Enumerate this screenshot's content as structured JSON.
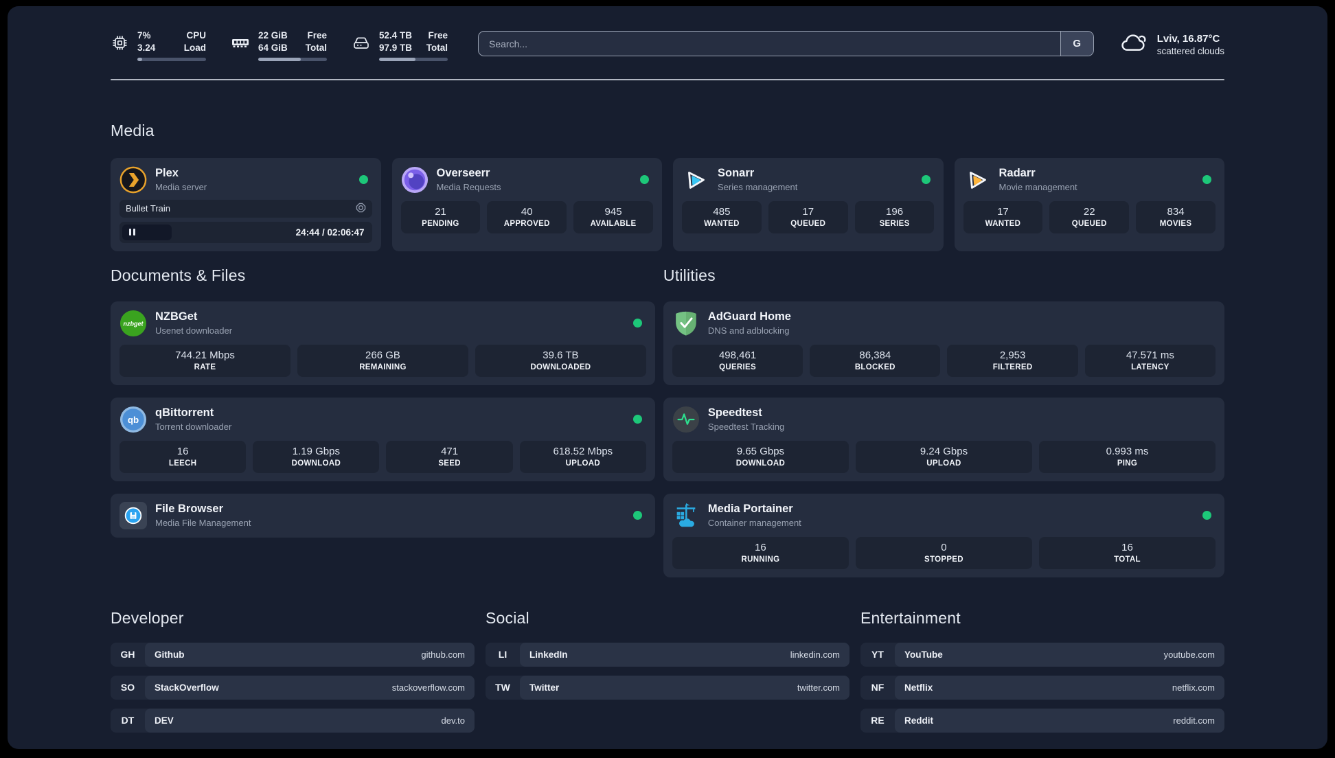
{
  "header": {
    "metrics": [
      {
        "icon": "cpu-icon",
        "values": [
          "7%",
          "3.24"
        ],
        "labels": [
          "CPU",
          "Load"
        ],
        "progress": 7
      },
      {
        "icon": "ram-icon",
        "values": [
          "22 GiB",
          "64 GiB"
        ],
        "labels": [
          "Free",
          "Total"
        ],
        "progress": 62
      },
      {
        "icon": "disk-icon",
        "values": [
          "52.4 TB",
          "97.9 TB"
        ],
        "labels": [
          "Free",
          "Total"
        ],
        "progress": 53
      }
    ],
    "search": {
      "placeholder": "Search...",
      "button": "G"
    },
    "weather": {
      "location_temp": "Lviv, 16.87°C",
      "condition": "scattered clouds"
    }
  },
  "media": {
    "title": "Media",
    "plex": {
      "name": "Plex",
      "subtitle": "Media server",
      "player": {
        "title": "Bullet Train",
        "time": "24:44 / 02:06:47"
      }
    },
    "overseerr": {
      "name": "Overseerr",
      "subtitle": "Media Requests",
      "stats": [
        {
          "value": "21",
          "label": "PENDING"
        },
        {
          "value": "40",
          "label": "APPROVED"
        },
        {
          "value": "945",
          "label": "AVAILABLE"
        }
      ]
    },
    "sonarr": {
      "name": "Sonarr",
      "subtitle": "Series management",
      "stats": [
        {
          "value": "485",
          "label": "WANTED"
        },
        {
          "value": "17",
          "label": "QUEUED"
        },
        {
          "value": "196",
          "label": "SERIES"
        }
      ]
    },
    "radarr": {
      "name": "Radarr",
      "subtitle": "Movie management",
      "stats": [
        {
          "value": "17",
          "label": "WANTED"
        },
        {
          "value": "22",
          "label": "QUEUED"
        },
        {
          "value": "834",
          "label": "MOVIES"
        }
      ]
    }
  },
  "documents": {
    "title": "Documents & Files",
    "nzbget": {
      "name": "NZBGet",
      "subtitle": "Usenet downloader",
      "stats": [
        {
          "value": "744.21 Mbps",
          "label": "RATE"
        },
        {
          "value": "266 GB",
          "label": "REMAINING"
        },
        {
          "value": "39.6 TB",
          "label": "DOWNLOADED"
        }
      ]
    },
    "qbittorrent": {
      "name": "qBittorrent",
      "subtitle": "Torrent downloader",
      "stats": [
        {
          "value": "16",
          "label": "LEECH"
        },
        {
          "value": "1.19 Gbps",
          "label": "DOWNLOAD"
        },
        {
          "value": "471",
          "label": "SEED"
        },
        {
          "value": "618.52 Mbps",
          "label": "UPLOAD"
        }
      ]
    },
    "filebrowser": {
      "name": "File Browser",
      "subtitle": "Media File Management"
    }
  },
  "utilities": {
    "title": "Utilities",
    "adguard": {
      "name": "AdGuard Home",
      "subtitle": "DNS and adblocking",
      "stats": [
        {
          "value": "498,461",
          "label": "QUERIES"
        },
        {
          "value": "86,384",
          "label": "BLOCKED"
        },
        {
          "value": "2,953",
          "label": "FILTERED"
        },
        {
          "value": "47.571 ms",
          "label": "LATENCY"
        }
      ]
    },
    "speedtest": {
      "name": "Speedtest",
      "subtitle": "Speedtest Tracking",
      "stats": [
        {
          "value": "9.65 Gbps",
          "label": "DOWNLOAD"
        },
        {
          "value": "9.24 Gbps",
          "label": "UPLOAD"
        },
        {
          "value": "0.993 ms",
          "label": "PING"
        }
      ]
    },
    "portainer": {
      "name": "Media Portainer",
      "subtitle": "Container management",
      "stats": [
        {
          "value": "16",
          "label": "RUNNING"
        },
        {
          "value": "0",
          "label": "STOPPED"
        },
        {
          "value": "16",
          "label": "TOTAL"
        }
      ]
    }
  },
  "links": {
    "developer": {
      "title": "Developer",
      "items": [
        {
          "abbr": "GH",
          "name": "Github",
          "url": "github.com"
        },
        {
          "abbr": "SO",
          "name": "StackOverflow",
          "url": "stackoverflow.com"
        },
        {
          "abbr": "DT",
          "name": "DEV",
          "url": "dev.to"
        }
      ]
    },
    "social": {
      "title": "Social",
      "items": [
        {
          "abbr": "LI",
          "name": "LinkedIn",
          "url": "linkedin.com"
        },
        {
          "abbr": "TW",
          "name": "Twitter",
          "url": "twitter.com"
        }
      ]
    },
    "entertainment": {
      "title": "Entertainment",
      "items": [
        {
          "abbr": "YT",
          "name": "YouTube",
          "url": "youtube.com"
        },
        {
          "abbr": "NF",
          "name": "Netflix",
          "url": "netflix.com"
        },
        {
          "abbr": "RE",
          "name": "Reddit",
          "url": "reddit.com"
        }
      ]
    }
  },
  "colors": {
    "status_green": "#1dc779",
    "accent_plex": "#e8a22b"
  }
}
